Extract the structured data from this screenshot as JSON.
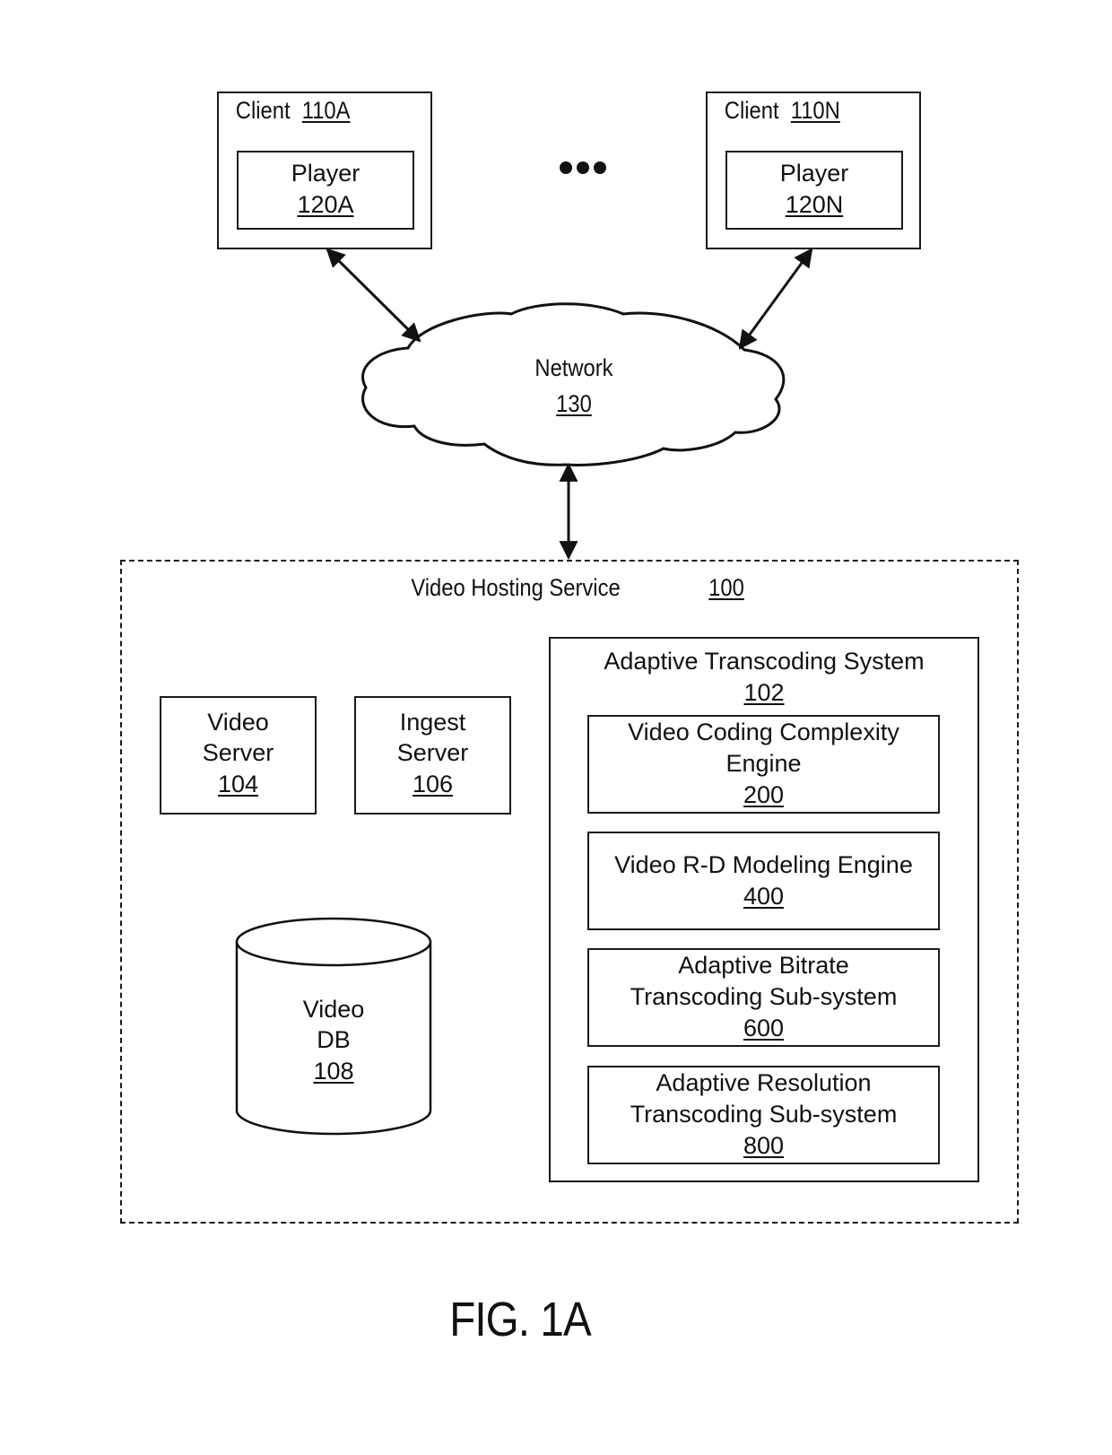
{
  "figure_label": "FIG. 1A",
  "ellipsis": "•••",
  "clients": [
    {
      "name": "Client",
      "ref": "110A",
      "player": {
        "name": "Player",
        "ref": "120A"
      }
    },
    {
      "name": "Client",
      "ref": "110N",
      "player": {
        "name": "Player",
        "ref": "120N"
      }
    }
  ],
  "network": {
    "name": "Network",
    "ref": "130"
  },
  "video_hosting_service": {
    "name": "Video Hosting Service",
    "ref": "100",
    "video_server": {
      "line1": "Video",
      "line2": "Server",
      "ref": "104"
    },
    "ingest_server": {
      "line1": "Ingest",
      "line2": "Server",
      "ref": "106"
    },
    "video_db": {
      "line1": "Video",
      "line2": "DB",
      "ref": "108"
    },
    "adaptive_transcoding_system": {
      "name": "Adaptive Transcoding System",
      "ref": "102",
      "components": [
        {
          "line1": "Video Coding Complexity",
          "line2": "Engine",
          "ref": "200"
        },
        {
          "line1": "Video R-D Modeling Engine",
          "line2": "",
          "ref": "400"
        },
        {
          "line1": "Adaptive Bitrate",
          "line2": "Transcoding Sub-system",
          "ref": "600"
        },
        {
          "line1": "Adaptive Resolution",
          "line2": "Transcoding Sub-system",
          "ref": "800"
        }
      ]
    }
  },
  "connections": [
    {
      "from": "Client 110A",
      "to": "Network 130",
      "direction": "bidirectional"
    },
    {
      "from": "Client 110N",
      "to": "Network 130",
      "direction": "bidirectional"
    },
    {
      "from": "Network 130",
      "to": "Video Hosting Service 100",
      "direction": "bidirectional"
    }
  ]
}
